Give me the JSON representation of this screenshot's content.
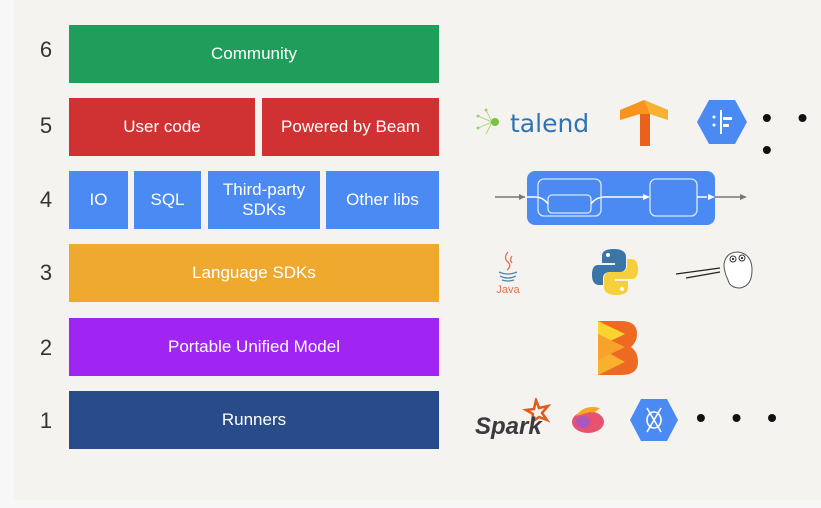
{
  "layers": [
    {
      "number": "6",
      "blocks": [
        {
          "label": "Community",
          "color": "#1f9e5b"
        }
      ]
    },
    {
      "number": "5",
      "blocks": [
        {
          "label": "User code",
          "color": "#d03233"
        },
        {
          "label": "Powered by Beam",
          "color": "#d03233"
        }
      ],
      "logos": [
        "talend-logo",
        "tensorflow-logo",
        "dataflow-logo"
      ],
      "more": "• • •"
    },
    {
      "number": "4",
      "blocks": [
        {
          "label": "IO",
          "color": "#4a8af2"
        },
        {
          "label": "SQL",
          "color": "#4a8af2"
        },
        {
          "label": "Third-party SDKs",
          "color": "#4a8af2"
        },
        {
          "label": "Other libs",
          "color": "#4a8af2"
        }
      ],
      "logos": [
        "pipeline-diagram"
      ]
    },
    {
      "number": "3",
      "blocks": [
        {
          "label": "Language SDKs",
          "color": "#eea92e"
        }
      ],
      "logos": [
        "java-logo",
        "python-logo",
        "go-gopher-logo"
      ],
      "java_text": "Java"
    },
    {
      "number": "2",
      "blocks": [
        {
          "label": "Portable Unified Model",
          "color": "#a024f2"
        }
      ],
      "logos": [
        "beam-logo"
      ]
    },
    {
      "number": "1",
      "blocks": [
        {
          "label": "Runners",
          "color": "#284b8a"
        }
      ],
      "logos": [
        "spark-logo",
        "flink-logo",
        "dataflow-logo"
      ],
      "spark_text": "Spark",
      "more": "• • •"
    }
  ]
}
